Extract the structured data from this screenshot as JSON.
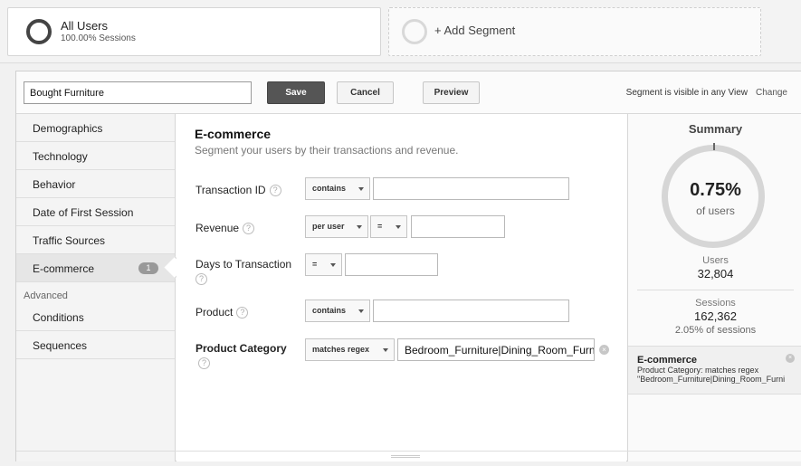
{
  "segments": {
    "active": {
      "title": "All Users",
      "subtitle": "100.00% Sessions"
    },
    "add_label": "+ Add Segment"
  },
  "toolbar": {
    "segment_name": "Bought Furniture",
    "save_label": "Save",
    "cancel_label": "Cancel",
    "preview_label": "Preview",
    "visibility_text": "Segment is visible in any View",
    "change_label": "Change"
  },
  "nav": {
    "items": [
      {
        "label": "Demographics"
      },
      {
        "label": "Technology"
      },
      {
        "label": "Behavior"
      },
      {
        "label": "Date of First Session"
      },
      {
        "label": "Traffic Sources"
      },
      {
        "label": "E-commerce",
        "badge": "1"
      }
    ],
    "advanced_heading": "Advanced",
    "advanced_items": [
      {
        "label": "Conditions"
      },
      {
        "label": "Sequences"
      }
    ]
  },
  "main": {
    "title": "E-commerce",
    "description": "Segment your users by their transactions and revenue.",
    "help_glyph": "?",
    "fields": {
      "transaction_id": {
        "label": "Transaction ID",
        "operator": "contains",
        "value": ""
      },
      "revenue": {
        "label": "Revenue",
        "scope": "per user",
        "operator": "=",
        "value": ""
      },
      "days_to_transaction": {
        "label": "Days to Transaction",
        "operator": "=",
        "value": ""
      },
      "product": {
        "label": "Product",
        "operator": "contains",
        "value": ""
      },
      "product_category": {
        "label": "Product Category",
        "operator": "matches regex",
        "value": "Bedroom_Furniture|Dining_Room_Furni"
      }
    }
  },
  "summary": {
    "title": "Summary",
    "percent": "0.75%",
    "percent_label": "of users",
    "users_label": "Users",
    "users_value": "32,804",
    "sessions_label": "Sessions",
    "sessions_value": "162,362",
    "sessions_pct": "2.05% of sessions",
    "filter": {
      "title": "E-commerce",
      "line1": "Product Category: matches regex",
      "line2": "\"Bedroom_Furniture|Dining_Room_Furni"
    }
  },
  "icons": {
    "close": "×"
  }
}
